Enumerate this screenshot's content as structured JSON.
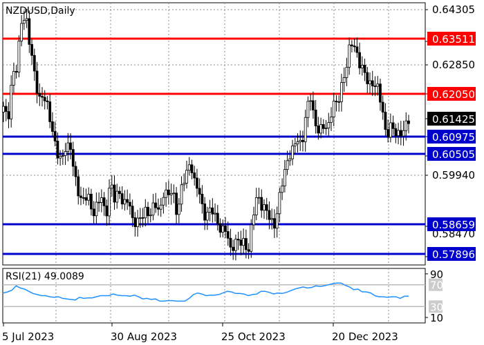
{
  "chart_data": {
    "type": "candlestick",
    "title": "NZDUSD,Daily",
    "price_ylim": [
      0.5762,
      0.6448
    ],
    "y_ticks": [
      "0.64305",
      "0.63511",
      "0.62850",
      "0.62050",
      "0.61425",
      "0.60975",
      "0.60505",
      "0.59940",
      "0.58659",
      "0.57896"
    ],
    "partial_tick": "0.58470",
    "x_ticks": [
      "5 Jul 2023",
      "30 Aug 2023",
      "25 Oct 2023",
      "20 Dec 2023"
    ],
    "levels": [
      {
        "value": 0.63511,
        "label": "0.63511",
        "color": "#ff0000"
      },
      {
        "value": 0.6205,
        "label": "0.62050",
        "color": "#ff0000"
      },
      {
        "value": 0.60975,
        "label": "0.60975",
        "color": "#0000cc"
      },
      {
        "value": 0.60505,
        "label": "0.60505",
        "color": "#0000cc"
      },
      {
        "value": 0.58659,
        "label": "0.58659",
        "color": "#0000cc"
      },
      {
        "value": 0.57896,
        "label": "0.57896",
        "color": "#0000cc"
      }
    ],
    "current_price": {
      "value": 0.61425,
      "label": "0.61425",
      "color": "#000000"
    },
    "rsi": {
      "label": "RSI(21) 49.0089",
      "period": 21,
      "last_value": 49.0089,
      "ylim": [
        0,
        100
      ],
      "levels": [
        70,
        30
      ],
      "axis_ticks": [
        "90",
        "10"
      ],
      "level_labels": [
        "70",
        "30"
      ],
      "color": "#1e90ff"
    },
    "grid": true,
    "candle_color": "#000000"
  },
  "path": [
    [
      0.617,
      0.614
    ],
    [
      0.6265,
      0.627
    ],
    [
      0.64,
      0.642
    ],
    [
      0.6325,
      0.626
    ],
    [
      0.62,
      0.62
    ],
    [
      0.617,
      0.612
    ],
    [
      0.605,
      0.603
    ],
    [
      0.608,
      0.607
    ],
    [
      0.599,
      0.595
    ],
    [
      0.593,
      0.594
    ],
    [
      0.59,
      0.592
    ],
    [
      0.5935,
      0.589
    ],
    [
      0.5985,
      0.5925
    ],
    [
      0.596,
      0.592
    ],
    [
      0.593,
      0.588
    ],
    [
      0.588,
      0.588
    ],
    [
      0.5905,
      0.59
    ],
    [
      0.592,
      0.5895
    ],
    [
      0.596,
      0.594
    ],
    [
      0.5955,
      0.59
    ],
    [
      0.596,
      0.5995
    ],
    [
      0.604,
      0.597
    ],
    [
      0.595,
      0.5895
    ],
    [
      0.59,
      0.59
    ],
    [
      0.588,
      0.585
    ],
    [
      0.585,
      0.5805
    ],
    [
      0.5825,
      0.5815
    ],
    [
      0.5825,
      0.58
    ],
    [
      0.588,
      0.595
    ],
    [
      0.592,
      0.59
    ],
    [
      0.588,
      0.587
    ],
    [
      0.5935,
      0.6
    ],
    [
      0.605,
      0.606
    ],
    [
      0.609,
      0.608
    ],
    [
      0.616,
      0.62
    ],
    [
      0.6135,
      0.611
    ],
    [
      0.612,
      0.613
    ],
    [
      0.6185,
      0.6175
    ],
    [
      0.624,
      0.628
    ],
    [
      0.634,
      0.6335
    ],
    [
      0.629,
      0.626
    ],
    [
      0.624,
      0.624
    ],
    [
      0.622,
      0.618
    ],
    [
      0.61,
      0.612
    ],
    [
      0.611,
      0.611
    ],
    [
      0.611,
      0.6142
    ]
  ],
  "rsi_path": [
    55,
    57,
    60,
    68,
    64,
    62,
    58,
    54,
    52,
    50,
    50,
    48,
    47,
    48,
    45,
    44,
    43,
    42,
    47,
    45,
    46,
    46,
    48,
    50,
    50,
    50,
    53,
    51,
    50,
    50,
    49,
    51,
    48,
    44,
    45,
    43,
    44,
    40,
    40,
    41,
    41,
    40,
    40,
    40,
    45,
    52,
    55,
    53,
    50,
    51,
    51,
    52,
    55,
    58,
    57,
    54,
    54,
    53,
    50,
    52,
    53,
    58,
    58,
    56,
    53,
    55,
    54,
    56,
    59,
    62,
    64,
    66,
    64,
    65,
    68,
    67,
    68,
    70,
    72,
    73,
    73,
    69,
    66,
    61,
    62,
    57,
    57,
    55,
    50,
    48,
    48,
    47,
    48,
    48,
    45,
    49,
    49
  ]
}
